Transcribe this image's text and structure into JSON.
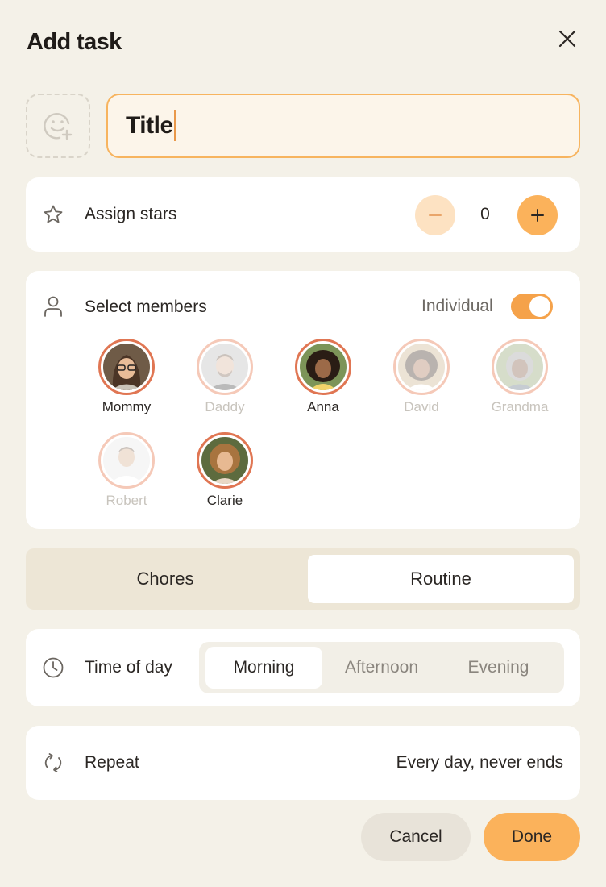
{
  "dialog": {
    "title": "Add task"
  },
  "title_field": {
    "value": "Title"
  },
  "stars": {
    "label": "Assign stars",
    "count": "0",
    "minus": "−",
    "plus": "+"
  },
  "members": {
    "label": "Select members",
    "individual_label": "Individual",
    "individual_on": true,
    "people": [
      {
        "name": "Mommy",
        "selected": true
      },
      {
        "name": "Daddy",
        "selected": false
      },
      {
        "name": "Anna",
        "selected": true
      },
      {
        "name": "David",
        "selected": false
      },
      {
        "name": "Grandma",
        "selected": false
      },
      {
        "name": "Robert",
        "selected": false
      },
      {
        "name": "Clarie",
        "selected": true
      }
    ]
  },
  "task_type": {
    "options": [
      "Chores",
      "Routine"
    ],
    "selected": "Routine"
  },
  "time_of_day": {
    "label": "Time of day",
    "options": [
      "Morning",
      "Afternoon",
      "Evening"
    ],
    "selected": "Morning"
  },
  "repeat": {
    "label": "Repeat",
    "value": "Every day, never ends"
  },
  "actions": {
    "cancel": "Cancel",
    "done": "Done"
  },
  "colors": {
    "accent": "#fbb25b",
    "selected_ring": "#e07653",
    "background": "#f4f1e8"
  }
}
